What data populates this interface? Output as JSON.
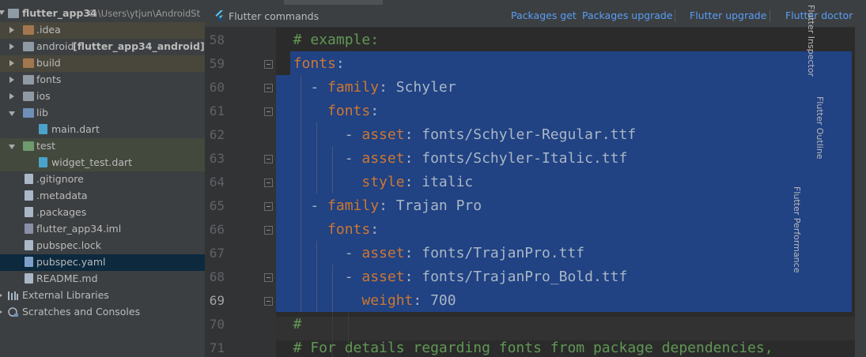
{
  "project_tree": {
    "root": {
      "name": "flutter_app34",
      "path": "C:\\Users\\ytjun\\AndroidSt"
    },
    "items": [
      {
        "label": ".idea",
        "kind": "folder-excluded",
        "expanded": false
      },
      {
        "label": "android",
        "suffix": "[flutter_app34_android]",
        "kind": "folder",
        "expanded": false
      },
      {
        "label": "build",
        "kind": "folder-excluded",
        "expanded": false
      },
      {
        "label": "fonts",
        "kind": "folder",
        "expanded": false
      },
      {
        "label": "ios",
        "kind": "folder",
        "expanded": false
      },
      {
        "label": "lib",
        "kind": "folder-src",
        "expanded": true
      },
      {
        "label": "main.dart",
        "kind": "file-dart"
      },
      {
        "label": "test",
        "kind": "folder-test",
        "expanded": true
      },
      {
        "label": "widget_test.dart",
        "kind": "file-dart"
      },
      {
        "label": ".gitignore",
        "kind": "file"
      },
      {
        "label": ".metadata",
        "kind": "file"
      },
      {
        "label": ".packages",
        "kind": "file"
      },
      {
        "label": "flutter_app34.iml",
        "kind": "file-iml"
      },
      {
        "label": "pubspec.lock",
        "kind": "file"
      },
      {
        "label": "pubspec.yaml",
        "kind": "file-yaml",
        "selected": true
      },
      {
        "label": "README.md",
        "kind": "file"
      },
      {
        "label": "External Libraries",
        "kind": "library"
      },
      {
        "label": "Scratches and Consoles",
        "kind": "scratches"
      }
    ]
  },
  "flutter_toolbar": {
    "title": "Flutter commands",
    "packages_get": "Packages get",
    "packages_upgrade": "Packages upgrade",
    "flutter_upgrade": "Flutter upgrade",
    "flutter_doctor": "Flutter doctor"
  },
  "right_panels": [
    "Flutter Inspector",
    "Flutter Outline",
    "Flutter Performance"
  ],
  "editor": {
    "current_line": 69,
    "lines": [
      {
        "num": "58",
        "parts": [
          {
            "t": "  # example:",
            "c": "comment"
          }
        ]
      },
      {
        "num": "59",
        "parts": [
          {
            "t": "  ",
            "c": ""
          },
          {
            "t": "fonts",
            "c": "key"
          },
          {
            "t": ":",
            "c": ""
          }
        ]
      },
      {
        "num": "60",
        "parts": [
          {
            "t": "    - ",
            "c": ""
          },
          {
            "t": "family",
            "c": "key"
          },
          {
            "t": ": Schyler",
            "c": ""
          }
        ]
      },
      {
        "num": "61",
        "parts": [
          {
            "t": "      ",
            "c": ""
          },
          {
            "t": "fonts",
            "c": "key"
          },
          {
            "t": ":",
            "c": ""
          }
        ]
      },
      {
        "num": "62",
        "parts": [
          {
            "t": "        - ",
            "c": ""
          },
          {
            "t": "asset",
            "c": "key"
          },
          {
            "t": ": fonts/Schyler-Regular.ttf",
            "c": ""
          }
        ]
      },
      {
        "num": "63",
        "parts": [
          {
            "t": "        - ",
            "c": ""
          },
          {
            "t": "asset",
            "c": "key"
          },
          {
            "t": ": fonts/Schyler-Italic.ttf",
            "c": ""
          }
        ]
      },
      {
        "num": "64",
        "parts": [
          {
            "t": "          ",
            "c": ""
          },
          {
            "t": "style",
            "c": "key"
          },
          {
            "t": ": italic",
            "c": ""
          }
        ]
      },
      {
        "num": "65",
        "parts": [
          {
            "t": "    - ",
            "c": ""
          },
          {
            "t": "family",
            "c": "key"
          },
          {
            "t": ": Trajan Pro",
            "c": ""
          }
        ]
      },
      {
        "num": "66",
        "parts": [
          {
            "t": "      ",
            "c": ""
          },
          {
            "t": "fonts",
            "c": "key"
          },
          {
            "t": ":",
            "c": ""
          }
        ]
      },
      {
        "num": "67",
        "parts": [
          {
            "t": "        - ",
            "c": ""
          },
          {
            "t": "asset",
            "c": "key"
          },
          {
            "t": ": fonts/TrajanPro.ttf",
            "c": ""
          }
        ]
      },
      {
        "num": "68",
        "parts": [
          {
            "t": "        - ",
            "c": ""
          },
          {
            "t": "asset",
            "c": "key"
          },
          {
            "t": ": fonts/TrajanPro_Bold.ttf",
            "c": ""
          }
        ]
      },
      {
        "num": "69",
        "parts": [
          {
            "t": "          ",
            "c": ""
          },
          {
            "t": "weight",
            "c": "key"
          },
          {
            "t": ": 700",
            "c": ""
          }
        ]
      },
      {
        "num": "70",
        "parts": [
          {
            "t": "  #",
            "c": "comment"
          }
        ]
      },
      {
        "num": "71",
        "parts": [
          {
            "t": "  # For details regarding fonts from package dependencies,",
            "c": "comment"
          }
        ]
      }
    ]
  },
  "colors": {
    "selection": "#214283",
    "key": "#cc7832",
    "comment": "#629755",
    "text": "#a9b7c6",
    "link": "#589df6"
  }
}
